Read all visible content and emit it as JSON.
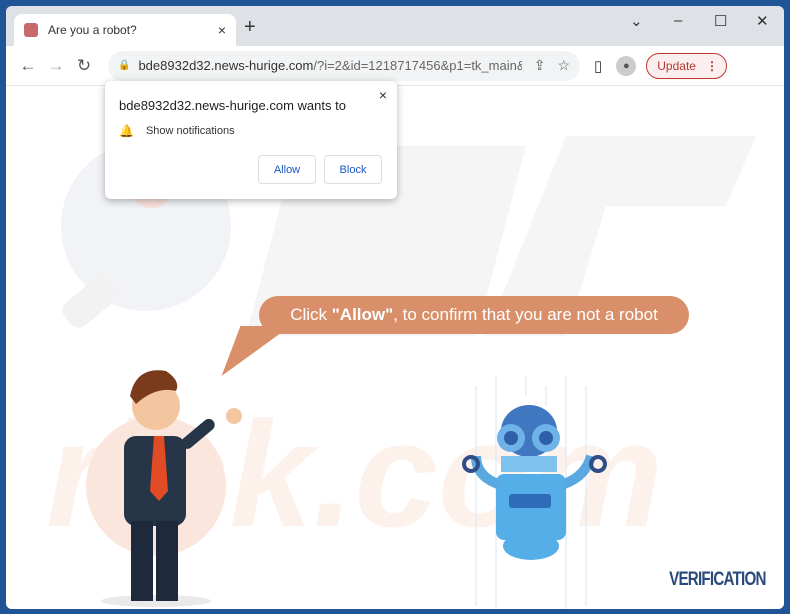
{
  "tab": {
    "title": "Are you a robot?",
    "close": "×",
    "new_tab": "+"
  },
  "window_controls": {
    "dropdown": "⌄",
    "minimize": "–",
    "maximize": "☐",
    "close": "✕"
  },
  "toolbar": {
    "back": "←",
    "forward": "→",
    "reload": "↻",
    "url_host": "bde8932d32.news-hurige.com",
    "url_rest": "/?i=2&id=1218717456&p1=tk_main&p2=&p...",
    "update_label": "Update",
    "menu": "⋮"
  },
  "popup": {
    "title": "bde8932d32.news-hurige.com wants to",
    "permission": "Show notifications",
    "allow": "Allow",
    "block": "Block",
    "close": "×"
  },
  "page": {
    "bubble_prefix": "Click ",
    "bubble_bold": "\"Allow\"",
    "bubble_suffix": ", to confirm that you are not a robot",
    "verification": "VERIFICATION"
  },
  "colors": {
    "bubble": "#d9906a",
    "accent": "#1a56c4",
    "update": "#b03a2e"
  }
}
